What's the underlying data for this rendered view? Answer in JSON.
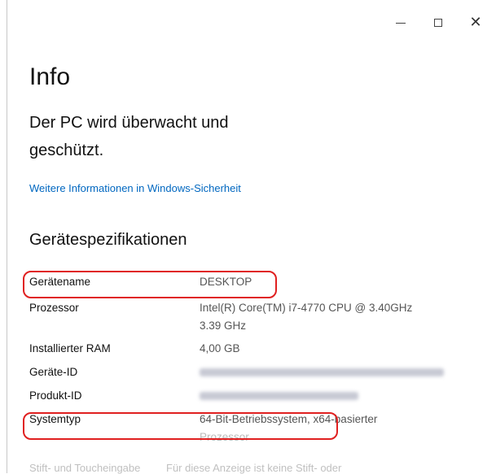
{
  "window": {
    "controls": {
      "minimize_icon": "minimize-icon",
      "maximize_icon": "maximize-icon",
      "close_glyph": "✕"
    }
  },
  "page": {
    "title": "Info",
    "headline": "Der PC wird überwacht und geschützt.",
    "security_link": "Weitere Informationen in Windows-Sicherheit"
  },
  "specs": {
    "title": "Gerätespezifikationen",
    "rows": [
      {
        "label": "Gerätename",
        "value": "DESKTOP"
      },
      {
        "label": "Prozessor",
        "value": "Intel(R) Core(TM) i7-4770 CPU @ 3.40GHz",
        "value2": "3.39 GHz"
      },
      {
        "label": "Installierter RAM",
        "value": "4,00 GB"
      },
      {
        "label": "Geräte-ID",
        "value": ""
      },
      {
        "label": "Produkt-ID",
        "value": ""
      },
      {
        "label": "Systemtyp",
        "value": "64-Bit-Betriebssystem, x64-basierter",
        "value2": "Prozessor"
      }
    ],
    "partial_row": {
      "label": "Stift- und Toucheingabe",
      "value": "Für diese Anzeige ist keine Stift- oder"
    }
  },
  "colors": {
    "link": "#0067c0",
    "highlight": "#e02020"
  }
}
